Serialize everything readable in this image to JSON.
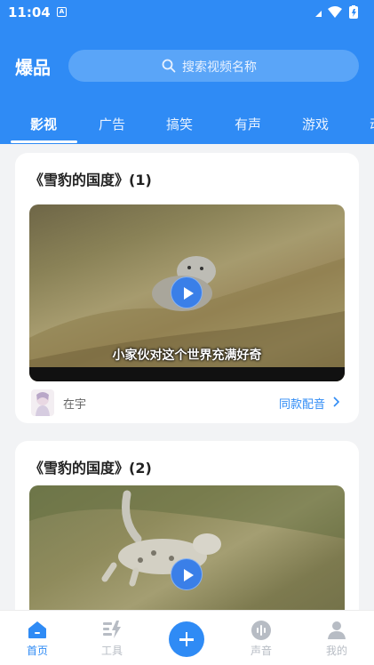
{
  "status_bar": {
    "time": "11:04",
    "notif_icon": "A"
  },
  "header": {
    "logo": "爆品",
    "search_placeholder": "搜索视频名称"
  },
  "tabs": [
    {
      "label": "影视",
      "active": true
    },
    {
      "label": "广告",
      "active": false
    },
    {
      "label": "搞笑",
      "active": false
    },
    {
      "label": "有声",
      "active": false
    },
    {
      "label": "游戏",
      "active": false
    },
    {
      "label": "动",
      "active": false
    }
  ],
  "cards": [
    {
      "title": "《雪豹的国度》(1)",
      "subtitle": "小家伙对这个世界充满好奇",
      "author": "在宇",
      "action": "同款配音"
    },
    {
      "title": "《雪豹的国度》(2)"
    }
  ],
  "bottom_nav": [
    {
      "label": "首页",
      "icon": "home-icon",
      "active": true
    },
    {
      "label": "工具",
      "icon": "tools-icon",
      "active": false
    },
    {
      "label": "",
      "icon": "plus-icon",
      "active": false
    },
    {
      "label": "声音",
      "icon": "voice-icon",
      "active": false
    },
    {
      "label": "我的",
      "icon": "profile-icon",
      "active": false
    }
  ],
  "colors": {
    "accent": "#2f8bf5",
    "inactive": "#b7bcc4"
  }
}
